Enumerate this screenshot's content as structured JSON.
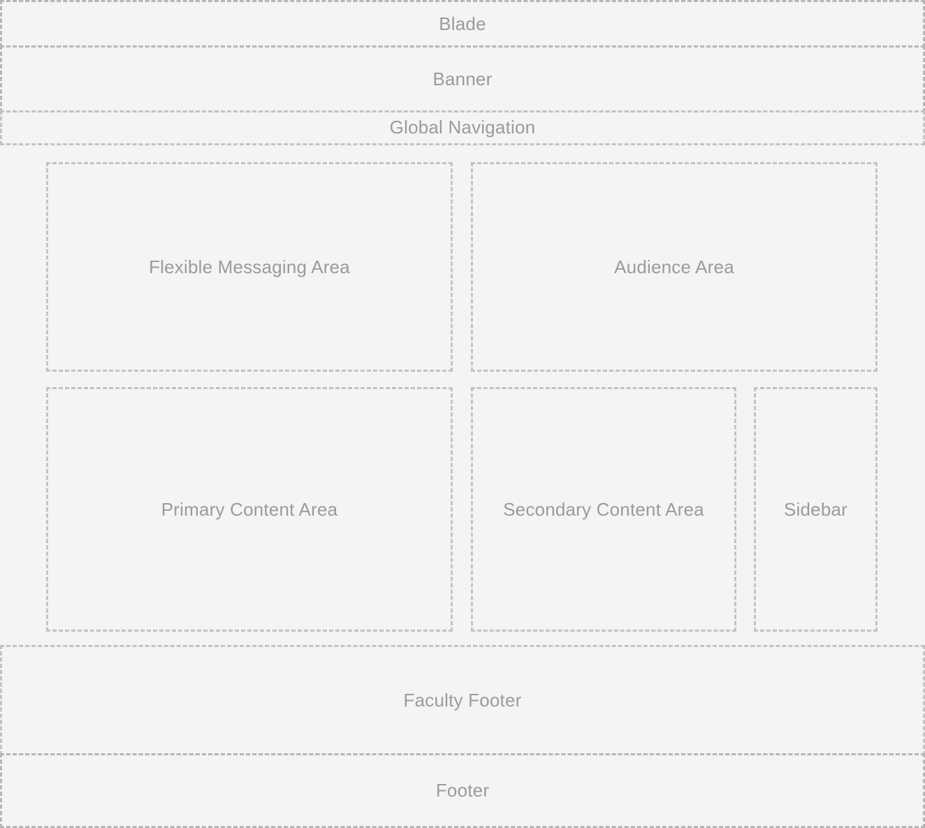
{
  "regions": {
    "blade": "Blade",
    "banner": "Banner",
    "global_navigation": "Global Navigation",
    "flexible_messaging_area": "Flexible Messaging Area",
    "audience_area": "Audience Area",
    "primary_content_area": "Primary Content Area",
    "secondary_content_area": "Secondary Content Area",
    "sidebar": "Sidebar",
    "faculty_footer": "Faculty Footer",
    "footer": "Footer"
  },
  "colors": {
    "background": "#f3f4f3",
    "border": "#c2c3c2",
    "text": "#9a9b9a"
  }
}
